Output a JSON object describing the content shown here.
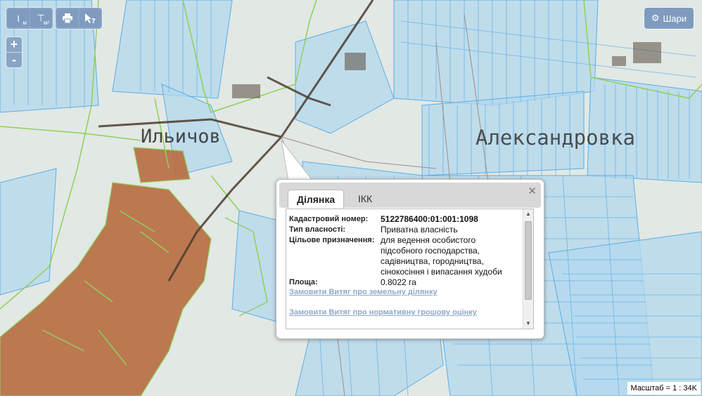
{
  "toolbar": {
    "measure_distance": "I",
    "measure_distance_unit": "м",
    "measure_area": "⊤",
    "measure_area_unit": "м²",
    "print_icon": "printer-icon",
    "identify_icon": "cursor-question-icon"
  },
  "zoom": {
    "in": "+",
    "out": "-"
  },
  "layers_button": {
    "label": "Шари",
    "icon": "gear-icon"
  },
  "map_labels": {
    "village_1": "Ильичов",
    "village_2": "Александровка"
  },
  "popup": {
    "tabs": [
      "Ділянка",
      "ІКК"
    ],
    "fields": [
      {
        "label": "Кадастровий номер:",
        "value": "5122786400:01:001:1098"
      },
      {
        "label": "Тип власності:",
        "value": "Приватна власність"
      },
      {
        "label": "Цільове призначення:",
        "value": "для ведення особистого підсобного господарства, садівництва, городництва, сінокосіння і випасання худоби"
      },
      {
        "label": "Площа:",
        "value": "0.8022 га"
      }
    ],
    "links": [
      "Замовити Витяг про земельну ділянку",
      "Замовити Витяг про нормативну грошову оцінку"
    ]
  },
  "scale": "Масштаб = 1 : 34K",
  "colors": {
    "parcel_fill": "#a9d2ec",
    "parcel_stroke": "#5aaee6",
    "green_boundary": "#8ed05a",
    "built_up": "#b56a3e",
    "road": "#4a3c30"
  }
}
